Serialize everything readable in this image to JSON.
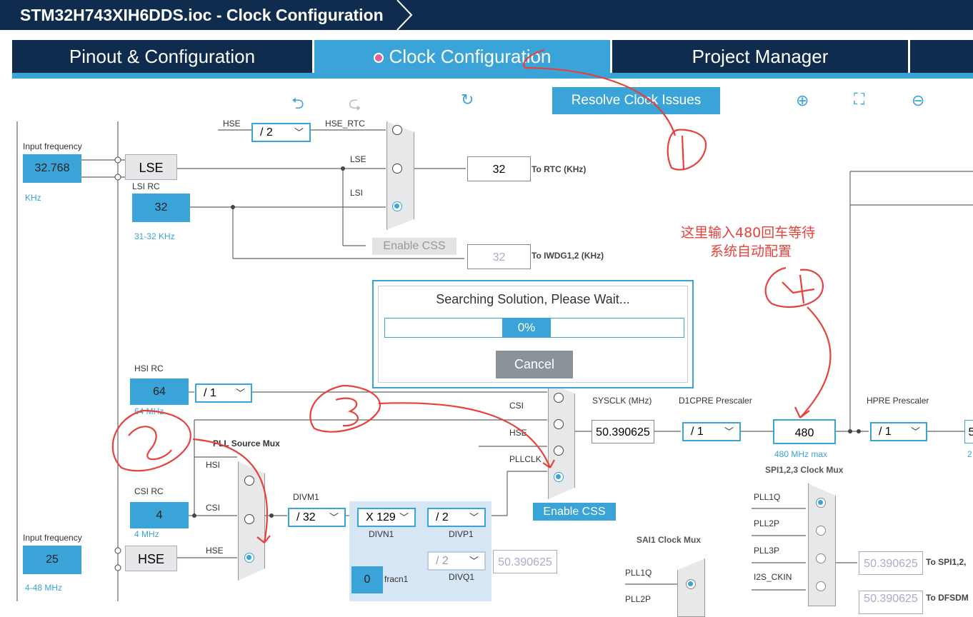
{
  "window": {
    "title": "STM32H743XIH6DDS.ioc - Clock Configuration"
  },
  "tabs": [
    {
      "label": "Pinout & Configuration"
    },
    {
      "label": "Clock Configuration"
    },
    {
      "label": "Project Manager"
    }
  ],
  "toolbar": {
    "resolve_label": "Resolve Clock Issues",
    "icons": [
      "undo-icon",
      "redo-icon",
      "reset-icon",
      "zoom-in-icon",
      "fit-icon",
      "zoom-out-icon"
    ]
  },
  "lse": {
    "input_label": "Input frequency",
    "value": "32.768",
    "unit": "KHz",
    "block": "LSE",
    "lsi_label": "LSI RC",
    "lsi_value": "32",
    "lsi_range": "31-32 KHz",
    "hse_div": "/ 2",
    "hse_label": "HSE",
    "hse_rtc_label": "HSE_RTC",
    "mux_lse_label": "LSE",
    "mux_lsi_label": "LSI",
    "rtc_value": "32",
    "rtc_label": "To RTC (KHz)",
    "css_label": "Enable CSS",
    "iwdg_value": "32",
    "iwdg_label": "To IWDG1,2 (KHz)"
  },
  "hsi": {
    "label": "HSI RC",
    "value": "64",
    "unit": "64 MHz",
    "div": "/ 1"
  },
  "csi": {
    "label": "CSI RC",
    "value": "4",
    "unit": "4 MHz"
  },
  "hse": {
    "input_label": "Input frequency",
    "value": "25",
    "range": "4-48 MHz",
    "block": "HSE"
  },
  "pll_mux": {
    "title": "PLL Source Mux",
    "hsi": "HSI",
    "csi": "CSI",
    "hse": "HSE"
  },
  "divm1": {
    "label": "DIVM1",
    "value": "/ 32"
  },
  "divn1": {
    "label": "DIVN1",
    "value": "X 129"
  },
  "divp1": {
    "label": "DIVP1",
    "value": "/ 2"
  },
  "divq1": {
    "label": "DIVQ1",
    "value": "/ 2",
    "out": "50.390625"
  },
  "fracn1": {
    "label": "fracn1",
    "value": "0"
  },
  "sysclk_mux": {
    "csi": "CSI",
    "hse": "HSE",
    "pllclk": "PLLCLK",
    "css_label": "Enable CSS"
  },
  "sysclk": {
    "label": "SYSCLK (MHz)",
    "value": "50.390625"
  },
  "d1cpre": {
    "label": "D1CPRE Prescaler",
    "value": "/ 1"
  },
  "hclk_in": {
    "value": "480",
    "max": "480 MHz max"
  },
  "hpre": {
    "label": "HPRE Prescaler",
    "value": "/ 1",
    "out_fragment": "5",
    "out_fragment2": "2"
  },
  "spi_mux": {
    "title": "SPI1,2,3 Clock Mux",
    "items": [
      "PLL1Q",
      "PLL2P",
      "PLL3P",
      "I2S_CKIN"
    ],
    "out": "50.390625",
    "out_label": "To SPI1,2,",
    "out2": "50.390625",
    "out2_label": "To DFSDM"
  },
  "sai_mux": {
    "title": "SAI1 Clock Mux",
    "items": [
      "PLL1Q",
      "PLL2P"
    ]
  },
  "dialog": {
    "message": "Searching Solution, Please Wait...",
    "progress": 0,
    "progress_label": "0%",
    "cancel_label": "Cancel"
  },
  "annotation": {
    "note_line1": "这里输入480回车等待",
    "note_line2": "系统自动配置",
    "colors": {
      "annotation": "#e8403a",
      "accent": "#3aa4d8",
      "dark": "#0f2c4e"
    }
  }
}
